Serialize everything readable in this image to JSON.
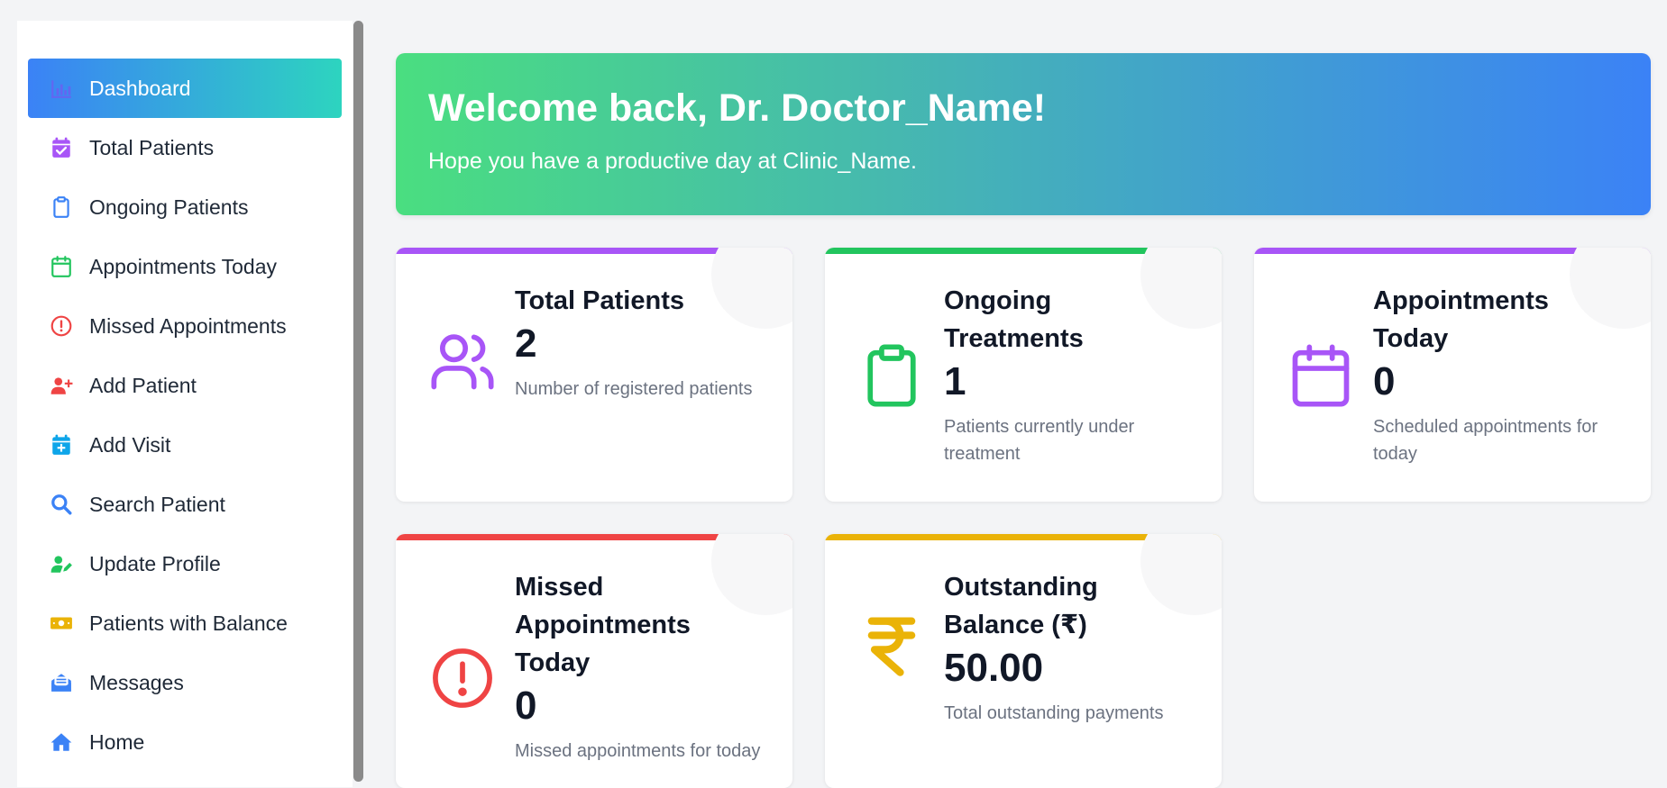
{
  "sidebar": {
    "items": [
      {
        "label": "Dashboard",
        "icon": "chart-bar-icon",
        "color": "#6366f1",
        "active": true
      },
      {
        "label": "Total Patients",
        "icon": "calendar-check-icon",
        "color": "#a855f7"
      },
      {
        "label": "Ongoing Patients",
        "icon": "clipboard-icon",
        "color": "#3b82f6"
      },
      {
        "label": "Appointments Today",
        "icon": "calendar-icon",
        "color": "#22c55e"
      },
      {
        "label": "Missed Appointments",
        "icon": "exclamation-circle-icon",
        "color": "#ef4444"
      },
      {
        "label": "Add Patient",
        "icon": "user-plus-icon",
        "color": "#ef4444"
      },
      {
        "label": "Add Visit",
        "icon": "calendar-plus-icon",
        "color": "#0ea5e9"
      },
      {
        "label": "Search Patient",
        "icon": "search-icon",
        "color": "#3b82f6"
      },
      {
        "label": "Update Profile",
        "icon": "user-edit-icon",
        "color": "#22c55e"
      },
      {
        "label": "Patients with Balance",
        "icon": "money-bill-icon",
        "color": "#eab308"
      },
      {
        "label": "Messages",
        "icon": "envelope-open-icon",
        "color": "#3b82f6"
      },
      {
        "label": "Home",
        "icon": "home-icon",
        "color": "#3b82f6"
      }
    ]
  },
  "banner": {
    "title": "Welcome back, Dr. Doctor_Name!",
    "subtitle": "Hope you have a productive day at Clinic_Name."
  },
  "cards": [
    {
      "title": "Total Patients",
      "value": "2",
      "desc": "Number of registered patients",
      "icon": "users-icon",
      "color": "#a855f7"
    },
    {
      "title": "Ongoing Treatments",
      "value": "1",
      "desc": "Patients currently under treatment",
      "icon": "clipboard-icon",
      "color": "#22c55e"
    },
    {
      "title": "Appointments Today",
      "value": "0",
      "desc": "Scheduled appointments for today",
      "icon": "calendar-icon",
      "color": "#a855f7"
    },
    {
      "title": "Missed Appointments Today",
      "value": "0",
      "desc": "Missed appointments for today",
      "icon": "exclamation-circle-icon",
      "color": "#ef4444"
    },
    {
      "title": "Outstanding Balance (₹)",
      "value": "50.00",
      "desc": "Total outstanding payments",
      "icon": "rupee-icon",
      "color": "#eab308"
    }
  ]
}
